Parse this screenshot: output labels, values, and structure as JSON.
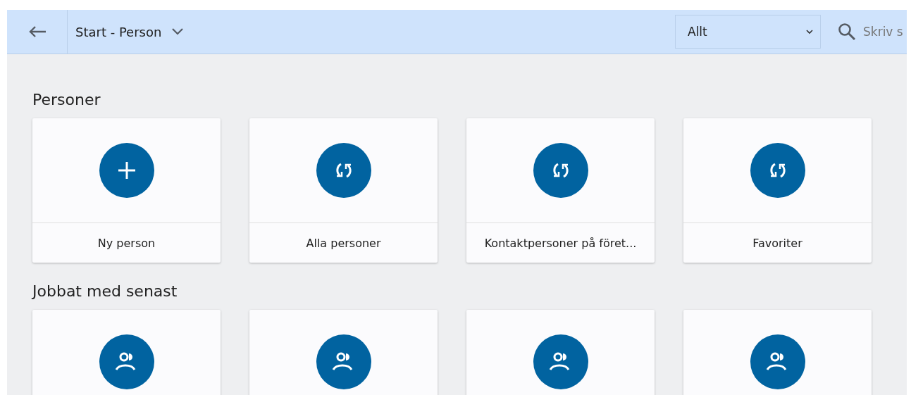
{
  "header": {
    "title": "Start - Person",
    "filter": "Allt",
    "search": {
      "placeholder": "Skriv s"
    }
  },
  "sections": [
    {
      "title": "Personer",
      "cards": [
        {
          "kind": "add",
          "label": "Ny person"
        },
        {
          "kind": "refresh",
          "label": "Alla personer"
        },
        {
          "kind": "refresh",
          "label": "Kontaktpersoner på föret..."
        },
        {
          "kind": "refresh",
          "label": "Favoriter"
        }
      ]
    },
    {
      "title": "Jobbat med senast",
      "cards": [
        {
          "kind": "person"
        },
        {
          "kind": "person"
        },
        {
          "kind": "person"
        },
        {
          "kind": "person"
        }
      ]
    }
  ]
}
